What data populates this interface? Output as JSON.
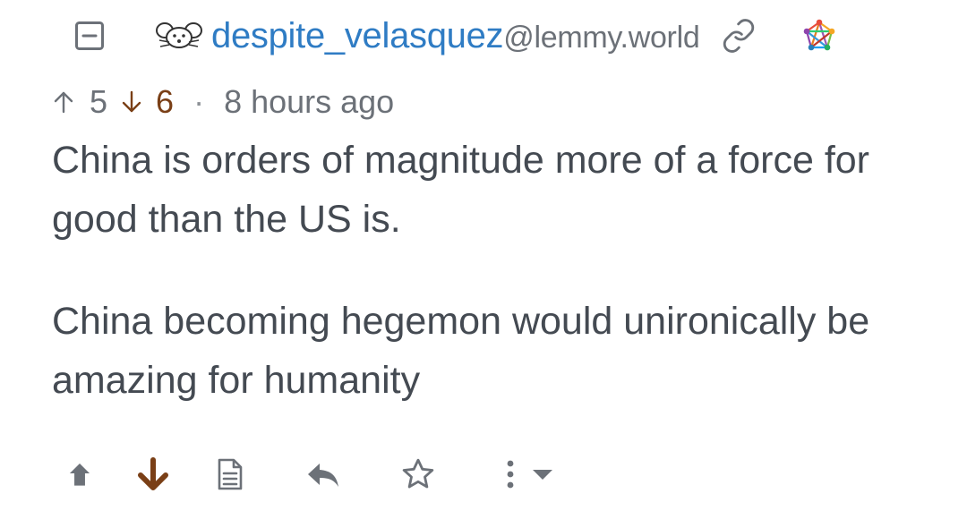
{
  "comment": {
    "author": {
      "username": "despite_velasquez",
      "instance": "@lemmy.world"
    },
    "score": {
      "upvotes": "5",
      "downvotes": "6",
      "separator": "·",
      "time": "8 hours ago"
    },
    "body": {
      "paragraph_1": "China is orders of magnitude more of a force for good than the US is.",
      "paragraph_2": "China becoming hegemon would unironically be amazing for humanity"
    },
    "user_vote": "downvote",
    "icons": {
      "collapse": "collapse-minus-icon",
      "avatar": "mouse-avatar-icon",
      "link": "link-icon",
      "fediverse": "fediverse-icon",
      "upvote": "arrow-up-icon",
      "downvote": "arrow-down-icon",
      "view_source": "document-icon",
      "reply": "reply-icon",
      "save": "star-icon",
      "more": "more-vertical-icon",
      "dropdown": "caret-down-icon"
    },
    "colors": {
      "username": "#2f7cc4",
      "text": "#444a52",
      "muted": "#6c7178",
      "downvoted": "#7a3f16",
      "icon": "#5f6368"
    }
  }
}
